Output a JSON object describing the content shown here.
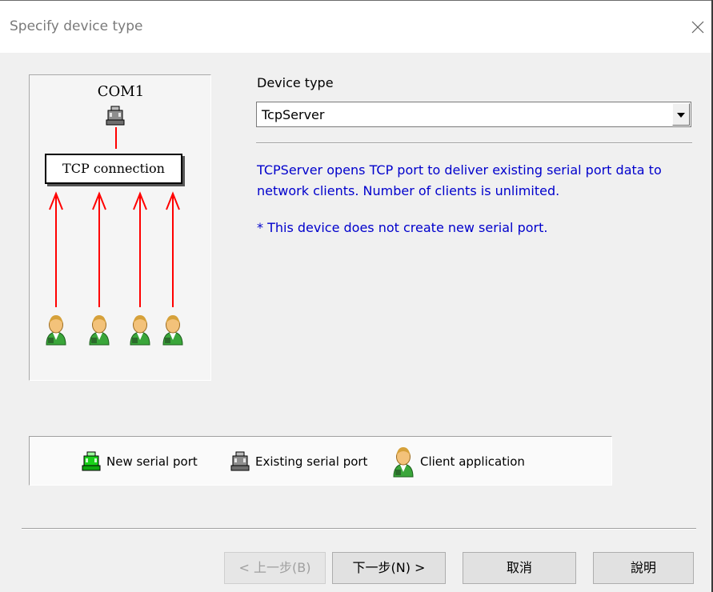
{
  "window": {
    "title": "Specify device type"
  },
  "diagram": {
    "port_label": "COM1",
    "connection_label": "TCP connection"
  },
  "device_type": {
    "label": "Device type",
    "selected": "TcpServer",
    "description": "TCPServer opens TCP port to deliver existing serial port data to network clients. Number of clients is unlimited.",
    "note": "* This device does not create new serial port."
  },
  "legend": {
    "new_port": "New serial port",
    "existing_port": "Existing serial port",
    "client_app": "Client application"
  },
  "buttons": {
    "back": "< 上一步(B)",
    "next": "下一步(N) >",
    "cancel": "取消",
    "help": "說明"
  },
  "colors": {
    "description_text": "#0000cc",
    "arrow": "#ff0000",
    "new_port_icon": "#22dd22",
    "existing_port_icon": "#555555"
  },
  "icons": [
    "close-icon",
    "existing-serial-port-icon",
    "client-application-icon",
    "new-serial-port-icon",
    "dropdown-arrow-icon"
  ]
}
